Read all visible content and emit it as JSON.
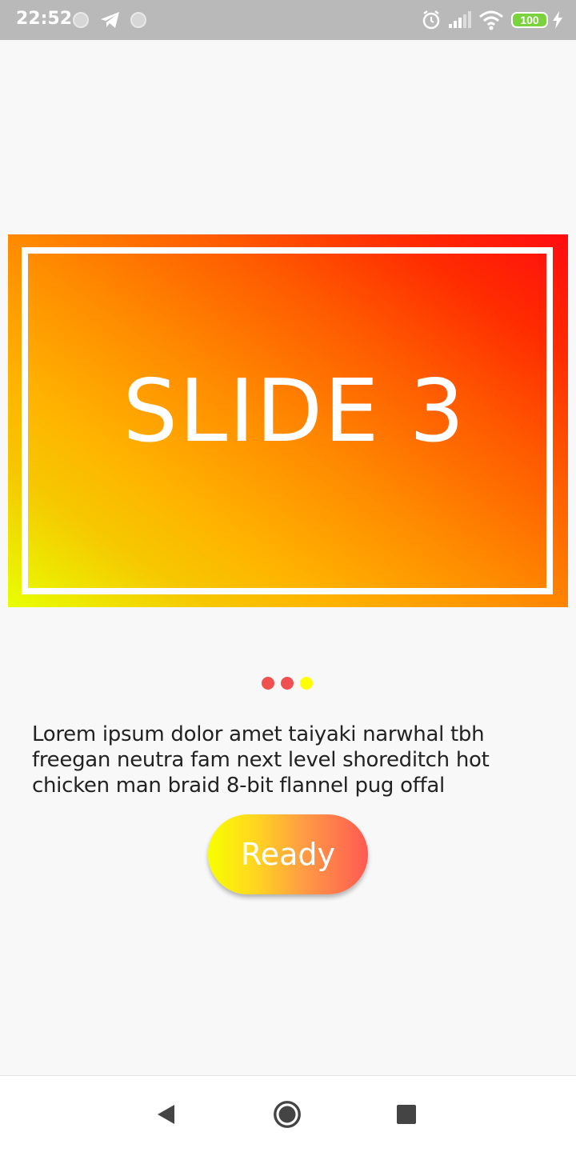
{
  "status_bar": {
    "time": "22:52",
    "notification_icons": [
      "notification-dot-icon",
      "telegram-icon",
      "notification-dot-icon"
    ],
    "right_icons": [
      "alarm-icon",
      "signal-icon",
      "wifi-icon",
      "battery-icon",
      "charging-icon"
    ],
    "battery_level": "100"
  },
  "slide": {
    "title": "SLIDE 3",
    "gradient_colors": [
      "#e8ff00",
      "#ffb300",
      "#ff5a00",
      "#ff0c10"
    ]
  },
  "pager": {
    "count": 3,
    "active_index": 2,
    "active_color": "#ffff00",
    "inactive_color": "#f05050"
  },
  "description": "Lorem ipsum dolor amet taiyaki narwhal tbh freegan neutra fam next level shoreditch hot chicken man braid 8-bit flannel pug offal",
  "ready_button": {
    "label": "Ready",
    "gradient_colors": [
      "#f8ff00",
      "#ff5a52"
    ]
  },
  "nav_bar": {
    "buttons": [
      "back-icon",
      "home-icon",
      "recents-icon"
    ]
  }
}
